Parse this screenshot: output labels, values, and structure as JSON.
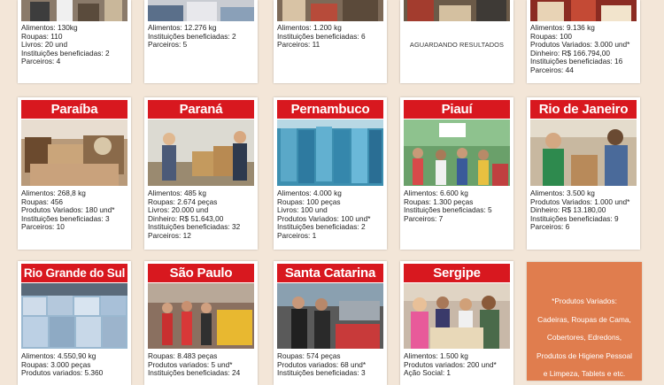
{
  "row1": [
    {
      "id": "c1",
      "stats": [
        "Alimentos: 130kg",
        "Roupas: 110",
        "Livros: 20 und",
        "Instituições beneficiadas: 2",
        "Parceiros: 4"
      ]
    },
    {
      "id": "c2",
      "stats": [
        "Alimentos: 12.276 kg",
        "Instituições beneficiadas: 2",
        "Parceiros: 5"
      ]
    },
    {
      "id": "c3",
      "stats": [
        "Alimentos: 1.200 kg",
        "Instituições beneficiadas: 6",
        "Parceiros: 11"
      ]
    },
    {
      "id": "c4",
      "await": "AGUARDANDO RESULTADOS"
    },
    {
      "id": "c5",
      "stats": [
        "Alimentos: 9.136 kg",
        "Roupas: 100",
        "Produtos Variados: 3.000 und*",
        "Dinheiro: R$ 166.794,00",
        "Instituições beneficiadas: 16",
        "Parceiros: 44"
      ]
    }
  ],
  "row2": [
    {
      "id": "pb",
      "title": "Paraíba",
      "stats": [
        "Alimentos: 268,8 kg",
        "Roupas: 456",
        "Produtos Variados: 180 und*",
        "Instituições beneficiadas: 3",
        "Parceiros: 10"
      ]
    },
    {
      "id": "pr",
      "title": "Paraná",
      "stats": [
        "Alimentos: 485 kg",
        "Roupas: 2.674 peças",
        "Livros: 20.000 und",
        "Dinheiro: R$ 51.643,00",
        "Instituições beneficiadas: 32",
        "Parceiros: 12"
      ]
    },
    {
      "id": "pe",
      "title": "Pernambuco",
      "stats": [
        "Alimentos: 4.000 kg",
        "Roupas: 100 peças",
        "Livros: 100 und",
        "Produtos Variados: 100 und*",
        "Instituições beneficiadas: 2",
        "Parceiros: 1"
      ]
    },
    {
      "id": "pi",
      "title": "Piauí",
      "stats": [
        "Alimentos: 6.600 kg",
        "Roupas: 1.300 peças",
        "Instituições beneficiadas: 5",
        "Parceiros: 7"
      ]
    },
    {
      "id": "rj",
      "title": "Rio de Janeiro",
      "stats": [
        "Alimentos: 3.500 kg",
        "Produtos Variados: 1.000 und*",
        "Dinheiro: R$ 13.180,00",
        "Instituições beneficiadas: 9",
        "Parceiros: 6"
      ]
    }
  ],
  "row3": [
    {
      "id": "rs",
      "title": "Rio Grande do Sul",
      "stats": [
        "Alimentos: 4.550,90 kg",
        "Roupas: 3.000 peças",
        "Produtos variados: 5.360"
      ]
    },
    {
      "id": "sp",
      "title": "São Paulo",
      "stats": [
        "Roupas: 8.483 peças",
        "Produtos variados: 5 und*",
        "Instituições beneficiadas: 24"
      ]
    },
    {
      "id": "sc",
      "title": "Santa Catarina",
      "stats": [
        "Roupas: 574 peças",
        "Produtos variados: 68 und*",
        "Instituições beneficiadas: 3"
      ]
    },
    {
      "id": "se",
      "title": "Sergipe",
      "stats": [
        "Alimentos: 1.500 kg",
        "Produtos variados: 200 und*",
        "Ação Social: 1"
      ]
    }
  ],
  "note": {
    "lines": [
      "*Produtos Variados:",
      "Cadeiras, Roupas de Cama,",
      "Cobertores, Edredons,",
      "Produtos de Higiene Pessoal",
      "e Limpeza, Tablets e etc."
    ],
    "color": "#e07d4e"
  },
  "colors": {
    "title_bg": "#d8181f",
    "background": "#f3e6d8"
  }
}
